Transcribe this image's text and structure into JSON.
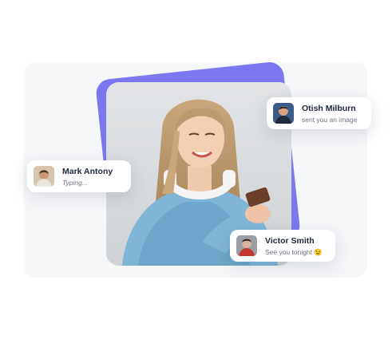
{
  "notifications": [
    {
      "name": "Otish Milburn",
      "message": "sent you an image",
      "emoji": "",
      "italic": false
    },
    {
      "name": "Mark Antony",
      "message": "Typing...",
      "emoji": "",
      "italic": true
    },
    {
      "name": "Victor Smith",
      "message": "See you tonight",
      "emoji": "😉",
      "italic": false
    }
  ],
  "colors": {
    "accent": "#7b77f0",
    "card_bg": "#ffffff",
    "name_text": "#1f2937",
    "message_text": "#6b7280"
  },
  "icons": [
    "avatar-otish-icon",
    "avatar-mark-icon",
    "avatar-victor-icon",
    "wink-emoji-icon"
  ]
}
